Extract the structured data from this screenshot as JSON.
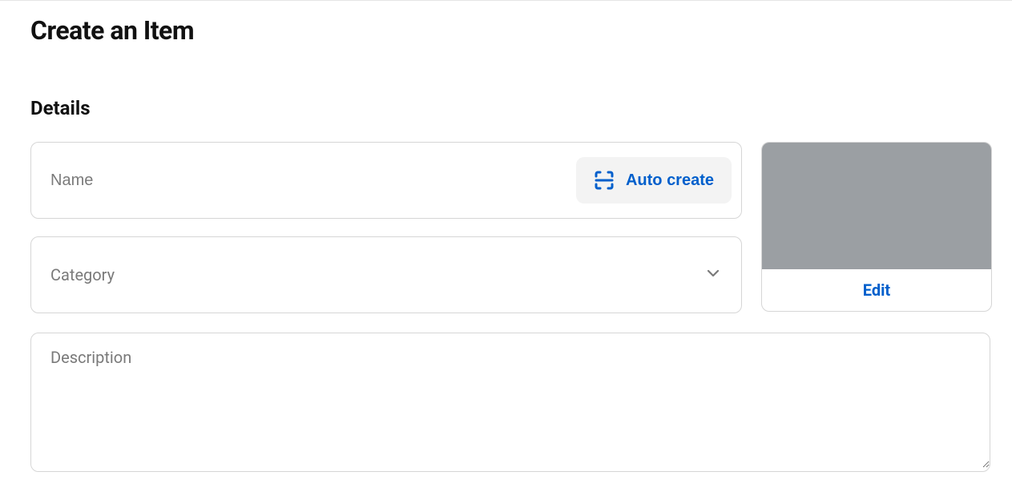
{
  "page": {
    "title": "Create an Item"
  },
  "details": {
    "section_title": "Details",
    "name": {
      "placeholder": "Name",
      "value": "",
      "auto_create_label": "Auto create"
    },
    "category": {
      "placeholder": "Category",
      "value": ""
    },
    "description": {
      "placeholder": "Description",
      "value": ""
    },
    "image": {
      "edit_label": "Edit"
    }
  }
}
